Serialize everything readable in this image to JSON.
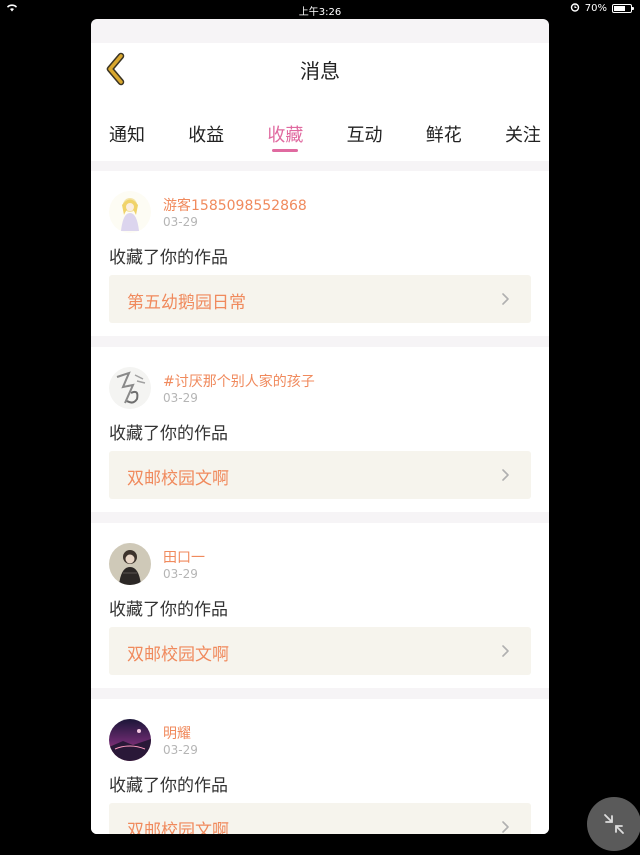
{
  "status": {
    "time": "上午3:26",
    "battery": "70%",
    "battery_level": 0.7
  },
  "header": {
    "title": "消息"
  },
  "tabs": [
    {
      "label": "通知",
      "active": false
    },
    {
      "label": "收益",
      "active": false
    },
    {
      "label": "收藏",
      "active": true
    },
    {
      "label": "互动",
      "active": false
    },
    {
      "label": "鲜花",
      "active": false
    },
    {
      "label": "关注",
      "active": false
    }
  ],
  "messages": [
    {
      "user": "游客1585098552868",
      "date": "03-29",
      "action": "收藏了你的作品",
      "work": "第五幼鹅园日常"
    },
    {
      "user": "#讨厌那个别人家的孩子",
      "date": "03-29",
      "action": "收藏了你的作品",
      "work": "双邮校园文啊"
    },
    {
      "user": "田口一",
      "date": "03-29",
      "action": "收藏了你的作品",
      "work": "双邮校园文啊"
    },
    {
      "user": "明耀",
      "date": "03-29",
      "action": "收藏了你的作品",
      "work": "双邮校园文啊"
    }
  ],
  "colors": {
    "accent": "#e06aa0",
    "username": "#f08a5d",
    "back_arrow": "#d9a72e"
  }
}
